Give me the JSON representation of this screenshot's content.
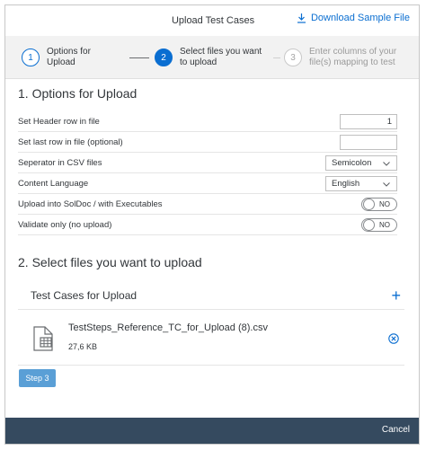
{
  "header": {
    "title": "Upload Test Cases",
    "download_label": "Download Sample File"
  },
  "wizard": {
    "steps": [
      {
        "number": "1",
        "label": "Options for Upload",
        "state": "completed"
      },
      {
        "number": "2",
        "label": "Select files you want to upload",
        "state": "active"
      },
      {
        "number": "3",
        "label": "Enter columns of your file(s) mapping to test",
        "state": "disabled"
      }
    ]
  },
  "options": {
    "section_title": "1. Options for Upload",
    "header_row_label": "Set Header row in file",
    "header_row_value": "1",
    "last_row_label": "Set last row in file (optional)",
    "last_row_value": "",
    "separator_label": "Seperator in CSV files",
    "separator_value": "Semicolon",
    "language_label": "Content Language",
    "language_value": "English",
    "upload_soldoc_label": "Upload into SolDoc / with Executables",
    "upload_soldoc_value": "NO",
    "validate_label": "Validate only (no upload)",
    "validate_value": "NO"
  },
  "select_files": {
    "section_title": "2. Select files you want to upload",
    "list_title": "Test Cases for Upload",
    "files": [
      {
        "name": "TestSteps_Reference_TC_for_Upload (8).csv",
        "size": "27,6 KB"
      }
    ]
  },
  "actions": {
    "step3_label": "Step 3",
    "cancel_label": "Cancel"
  },
  "colors": {
    "accent": "#0a6ed1",
    "footer": "#354a5f",
    "wizard_bg": "#f2f2f2"
  }
}
